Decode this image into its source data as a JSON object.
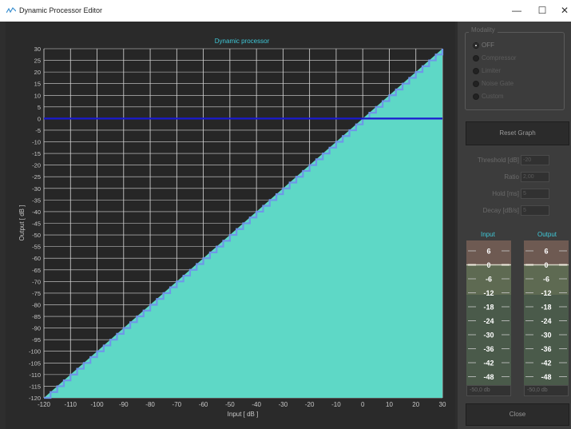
{
  "window": {
    "title": "Dynamic Processor Editor",
    "icon": "app-wave-icon",
    "minimize_glyph": "—",
    "maximize_glyph": "☐",
    "close_glyph": "✕"
  },
  "chart_data": {
    "type": "line",
    "title": "Dynamic processor",
    "xlabel": "Input [ dB ]",
    "ylabel": "Output [ dB ]",
    "xlim": [
      -120,
      30
    ],
    "ylim": [
      -120,
      30
    ],
    "x_ticks": [
      -120,
      -110,
      -100,
      -90,
      -80,
      -70,
      -60,
      -50,
      -40,
      -30,
      -20,
      -10,
      0,
      10,
      20,
      30
    ],
    "y_ticks": [
      30,
      25,
      20,
      15,
      10,
      5,
      0,
      -5,
      -10,
      -15,
      -20,
      -25,
      -30,
      -35,
      -40,
      -45,
      -50,
      -55,
      -60,
      -65,
      -70,
      -75,
      -80,
      -85,
      -90,
      -95,
      -100,
      -105,
      -110,
      -115,
      -120
    ],
    "grid": true,
    "series": [
      {
        "values": [
          [
            -120,
            -120
          ],
          [
            30,
            30
          ]
        ],
        "color": "#5ed8c6",
        "style": "filled-area"
      },
      {
        "values": [
          [
            -120,
            0
          ],
          [
            30,
            0
          ]
        ],
        "color": "#1a1ad0",
        "style": "line"
      }
    ],
    "colors": {
      "background": "#262626",
      "grid": "#d8d8d8",
      "title": "#3fc8d8",
      "axis_text": "#c8c8c8"
    }
  },
  "modality": {
    "legend": "Modality",
    "options": [
      {
        "label": "OFF",
        "selected": true
      },
      {
        "label": "Compressor",
        "selected": false
      },
      {
        "label": "Limiter",
        "selected": false
      },
      {
        "label": "Noise Gate",
        "selected": false
      },
      {
        "label": "Custom",
        "selected": false
      }
    ]
  },
  "reset_label": "Reset Graph",
  "params": [
    {
      "label": "Threshold [dB]",
      "value": "-20"
    },
    {
      "label": "Ratio",
      "value": "2,00"
    },
    {
      "label": "Hold [ms]",
      "value": "5"
    },
    {
      "label": "Decay [dB/s]",
      "value": "5"
    }
  ],
  "meters": {
    "input": {
      "title": "Input",
      "readout": "-50,0 db"
    },
    "output": {
      "title": "Output",
      "readout": "-50,0 db"
    },
    "scale": [
      "6",
      "0",
      "-6",
      "-12",
      "-18",
      "-24",
      "-30",
      "-36",
      "-42",
      "-48"
    ]
  },
  "close_label": "Close"
}
